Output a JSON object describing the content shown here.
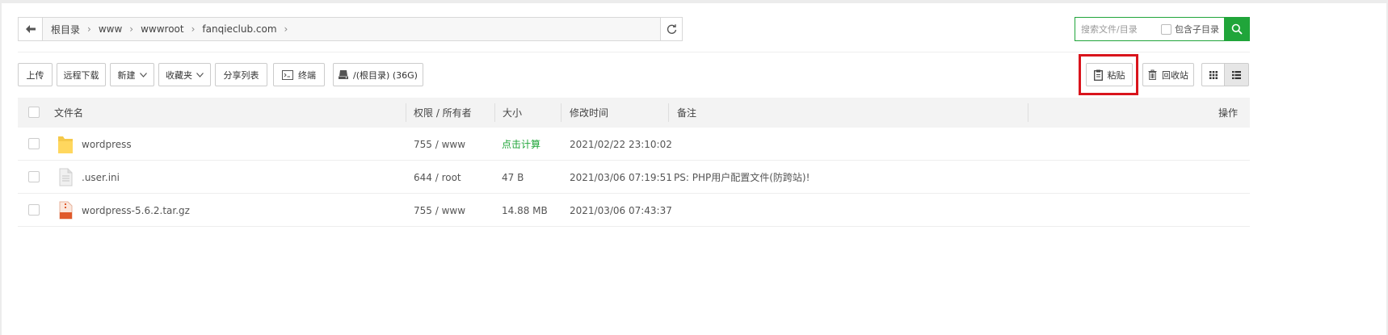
{
  "breadcrumb": [
    "根目录",
    "www",
    "wwwroot",
    "fanqieclub.com"
  ],
  "search": {
    "placeholder": "搜索文件/目录",
    "include_sub_label": "包含子目录",
    "include_sub_checked": false
  },
  "toolbar": {
    "upload": "上传",
    "remote_download": "远程下载",
    "new": "新建",
    "favorites": "收藏夹",
    "share_list": "分享列表",
    "terminal": "终端",
    "disk": "/(根目录) (36G)",
    "paste": "粘贴",
    "recycle": "回收站"
  },
  "table": {
    "headers": {
      "name": "文件名",
      "perm": "权限 / 所有者",
      "size": "大小",
      "mtime": "修改时间",
      "note": "备注",
      "ops": "操作"
    },
    "rows": [
      {
        "icon": "folder-icon",
        "name": "wordpress",
        "perm": "755 / www",
        "size": "点击计算",
        "mtime": "2021/02/22 23:10:02",
        "note": ""
      },
      {
        "icon": "file-icon",
        "name": ".user.ini",
        "perm": "644 / root",
        "size": "47 B",
        "mtime": "2021/03/06 07:19:51",
        "note": "PS: PHP用户配置文件(防跨站)!"
      },
      {
        "icon": "archive-icon",
        "name": "wordpress-5.6.2.tar.gz",
        "perm": "755 / www",
        "size": "14.88 MB",
        "mtime": "2021/03/06 07:43:37",
        "note": ""
      }
    ]
  },
  "colors": {
    "accent": "#20a53a",
    "highlight": "#d9141c"
  }
}
